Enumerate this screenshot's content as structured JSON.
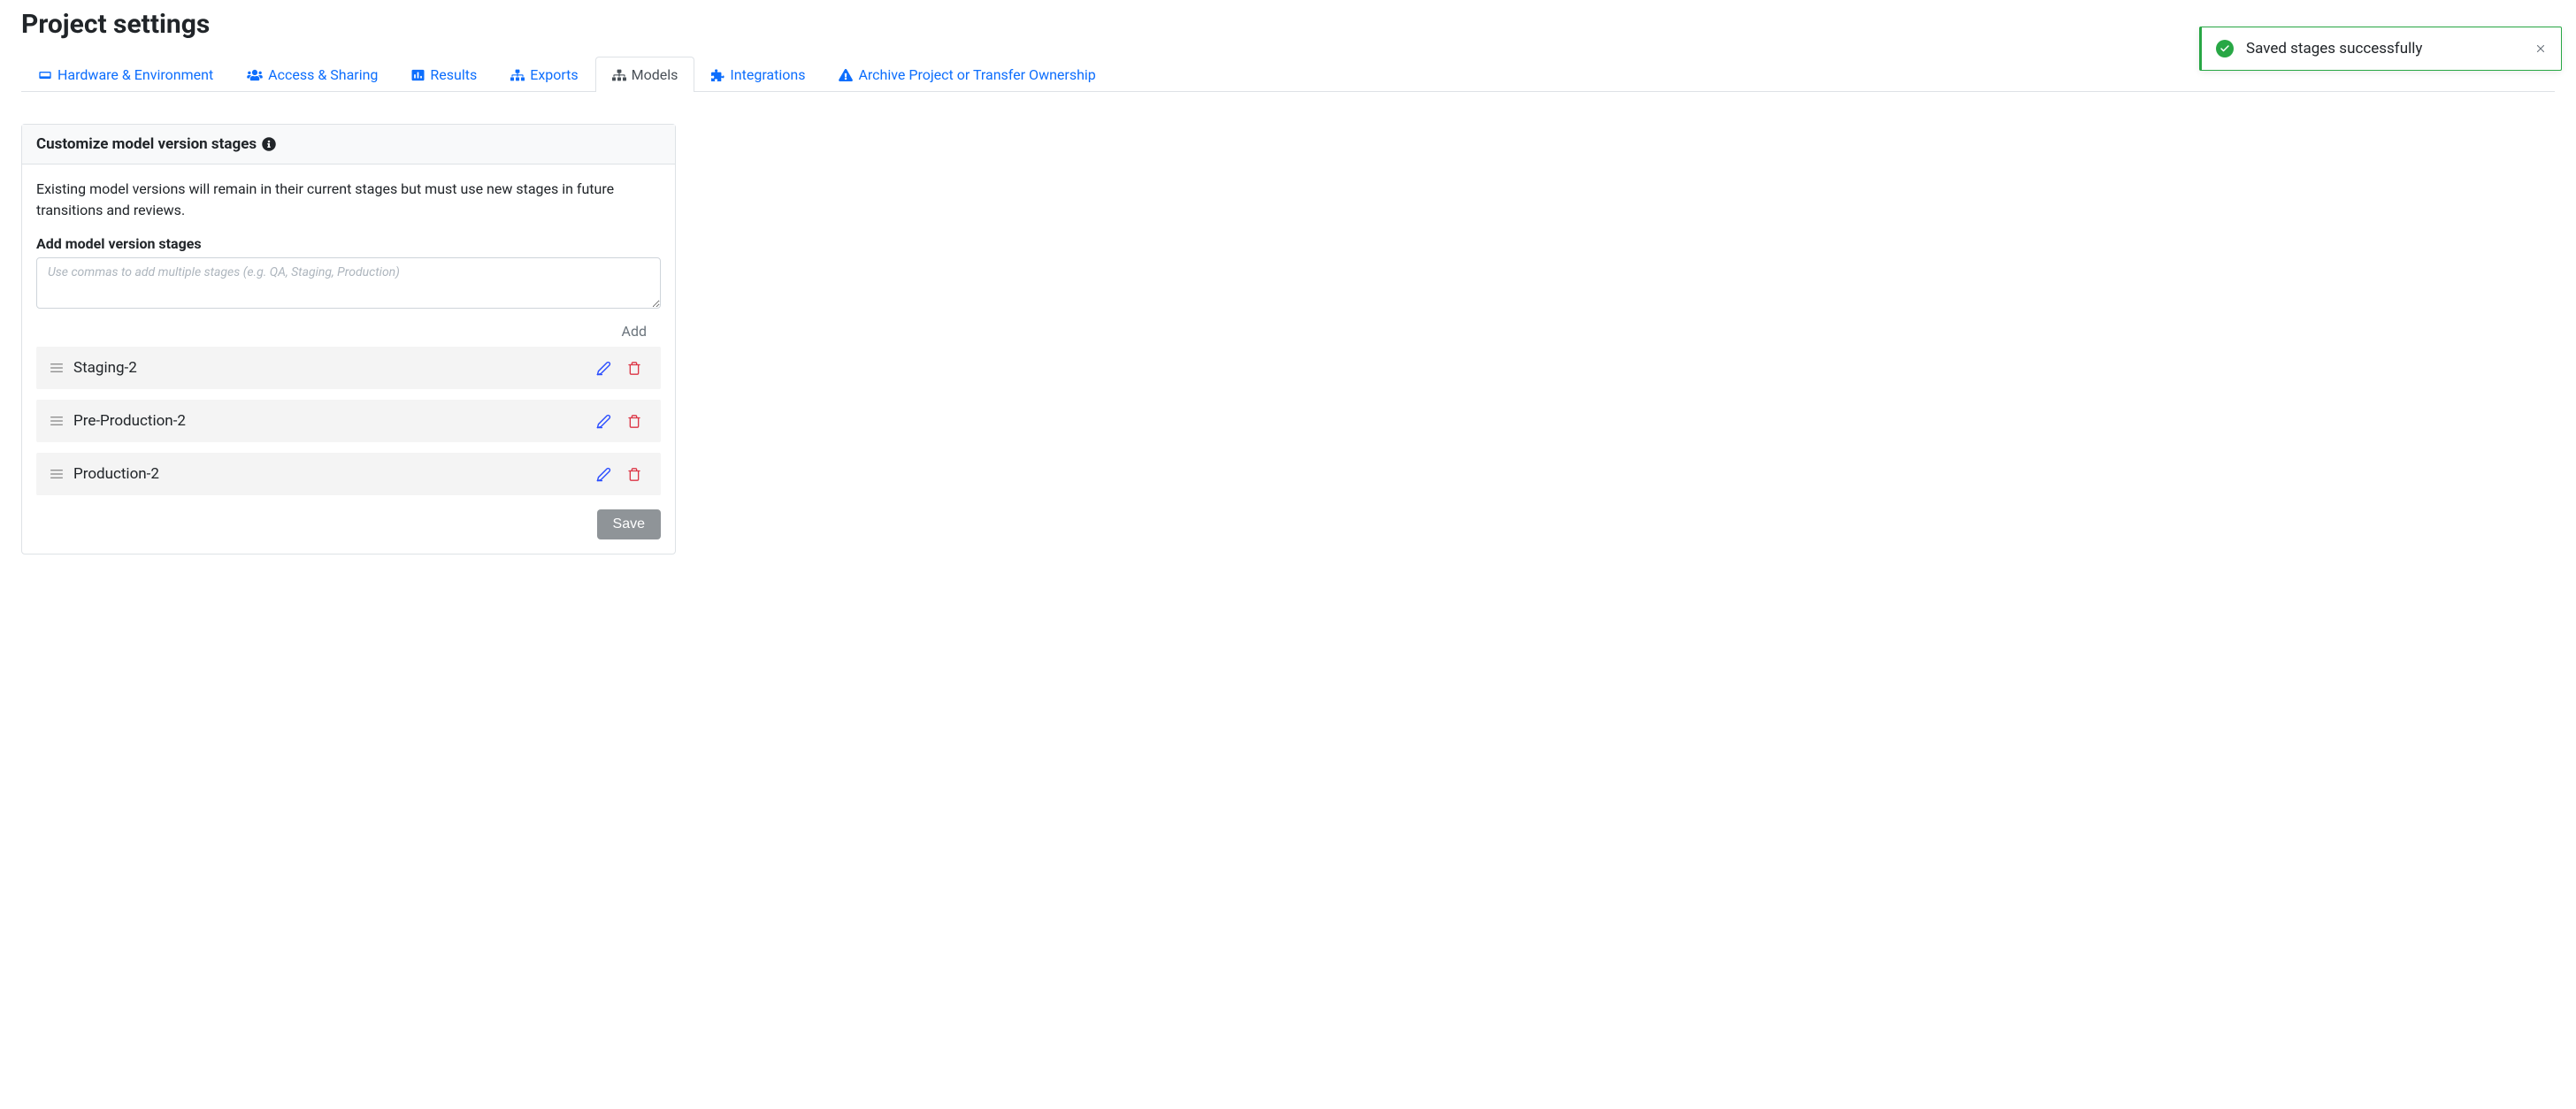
{
  "page": {
    "title": "Project settings"
  },
  "tabs": [
    {
      "label": "Hardware & Environment",
      "icon": "hardware"
    },
    {
      "label": "Access & Sharing",
      "icon": "users"
    },
    {
      "label": "Results",
      "icon": "chart"
    },
    {
      "label": "Exports",
      "icon": "sitemap"
    },
    {
      "label": "Models",
      "icon": "sitemap",
      "active": true
    },
    {
      "label": "Integrations",
      "icon": "puzzle"
    },
    {
      "label": "Archive Project or Transfer Ownership",
      "icon": "warning"
    }
  ],
  "panel": {
    "header": "Customize model version stages",
    "description": "Existing model versions will remain in their current stages but must use new stages in future transitions and reviews.",
    "form_label": "Add model version stages",
    "textarea_placeholder": "Use commas to add multiple stages (e.g. QA, Staging, Production)",
    "add_label": "Add",
    "stages": [
      {
        "name": "Staging-2"
      },
      {
        "name": "Pre-Production-2"
      },
      {
        "name": "Production-2"
      }
    ],
    "save_label": "Save"
  },
  "toast": {
    "message": "Saved stages successfully"
  }
}
